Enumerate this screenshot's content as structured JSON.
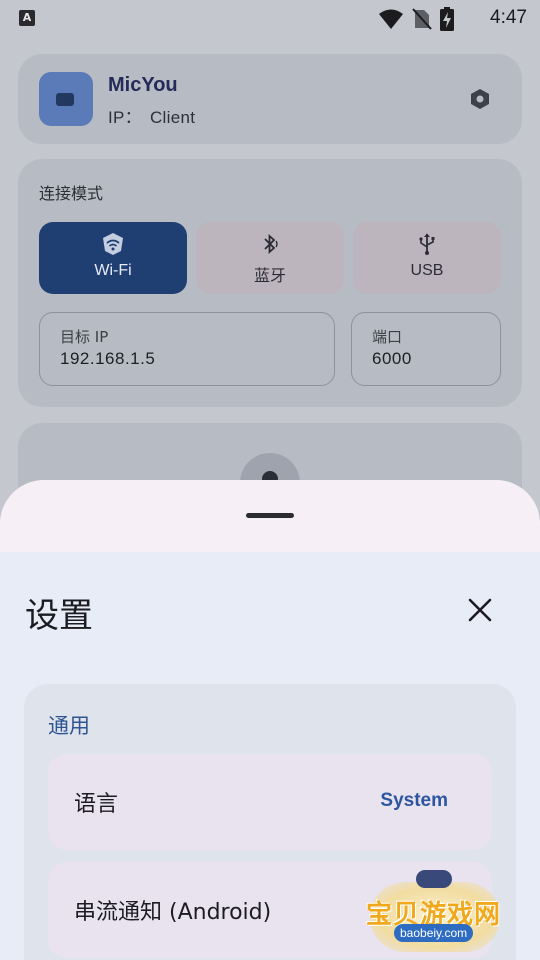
{
  "status_bar": {
    "left_badge": "A",
    "time": "4:47",
    "icons": [
      "wifi-icon",
      "no-sim-icon",
      "battery-charging-icon"
    ]
  },
  "header_card": {
    "app_name": "MicYou",
    "ip_label": "IP：",
    "ip_value": "Client",
    "settings_icon": "hexagon-settings-icon"
  },
  "connection": {
    "label": "连接模式",
    "modes": [
      {
        "label": "Wi-Fi",
        "icon": "wifi-shield-icon",
        "selected": true
      },
      {
        "label": "蓝牙",
        "icon": "bluetooth-icon",
        "selected": false
      },
      {
        "label": "USB",
        "icon": "usb-icon",
        "selected": false
      }
    ],
    "target_ip": {
      "label": "目标 IP",
      "value": "192.168.1.5"
    },
    "port": {
      "label": "端口",
      "value": "6000"
    }
  },
  "sheet": {
    "title": "设置",
    "close_icon": "close-icon",
    "section_general": {
      "title": "通用",
      "rows": [
        {
          "label": "语言",
          "value": "System"
        },
        {
          "label": "串流通知 (Android)",
          "value": ""
        }
      ]
    }
  },
  "watermark": {
    "text": "宝贝游戏网",
    "url": "baobeiy.com"
  },
  "colors": {
    "accent": "#1f3f73",
    "accent_text": "#2d55a0",
    "section_title": "#2e5591",
    "scrim_background": "#c4c7cd"
  }
}
